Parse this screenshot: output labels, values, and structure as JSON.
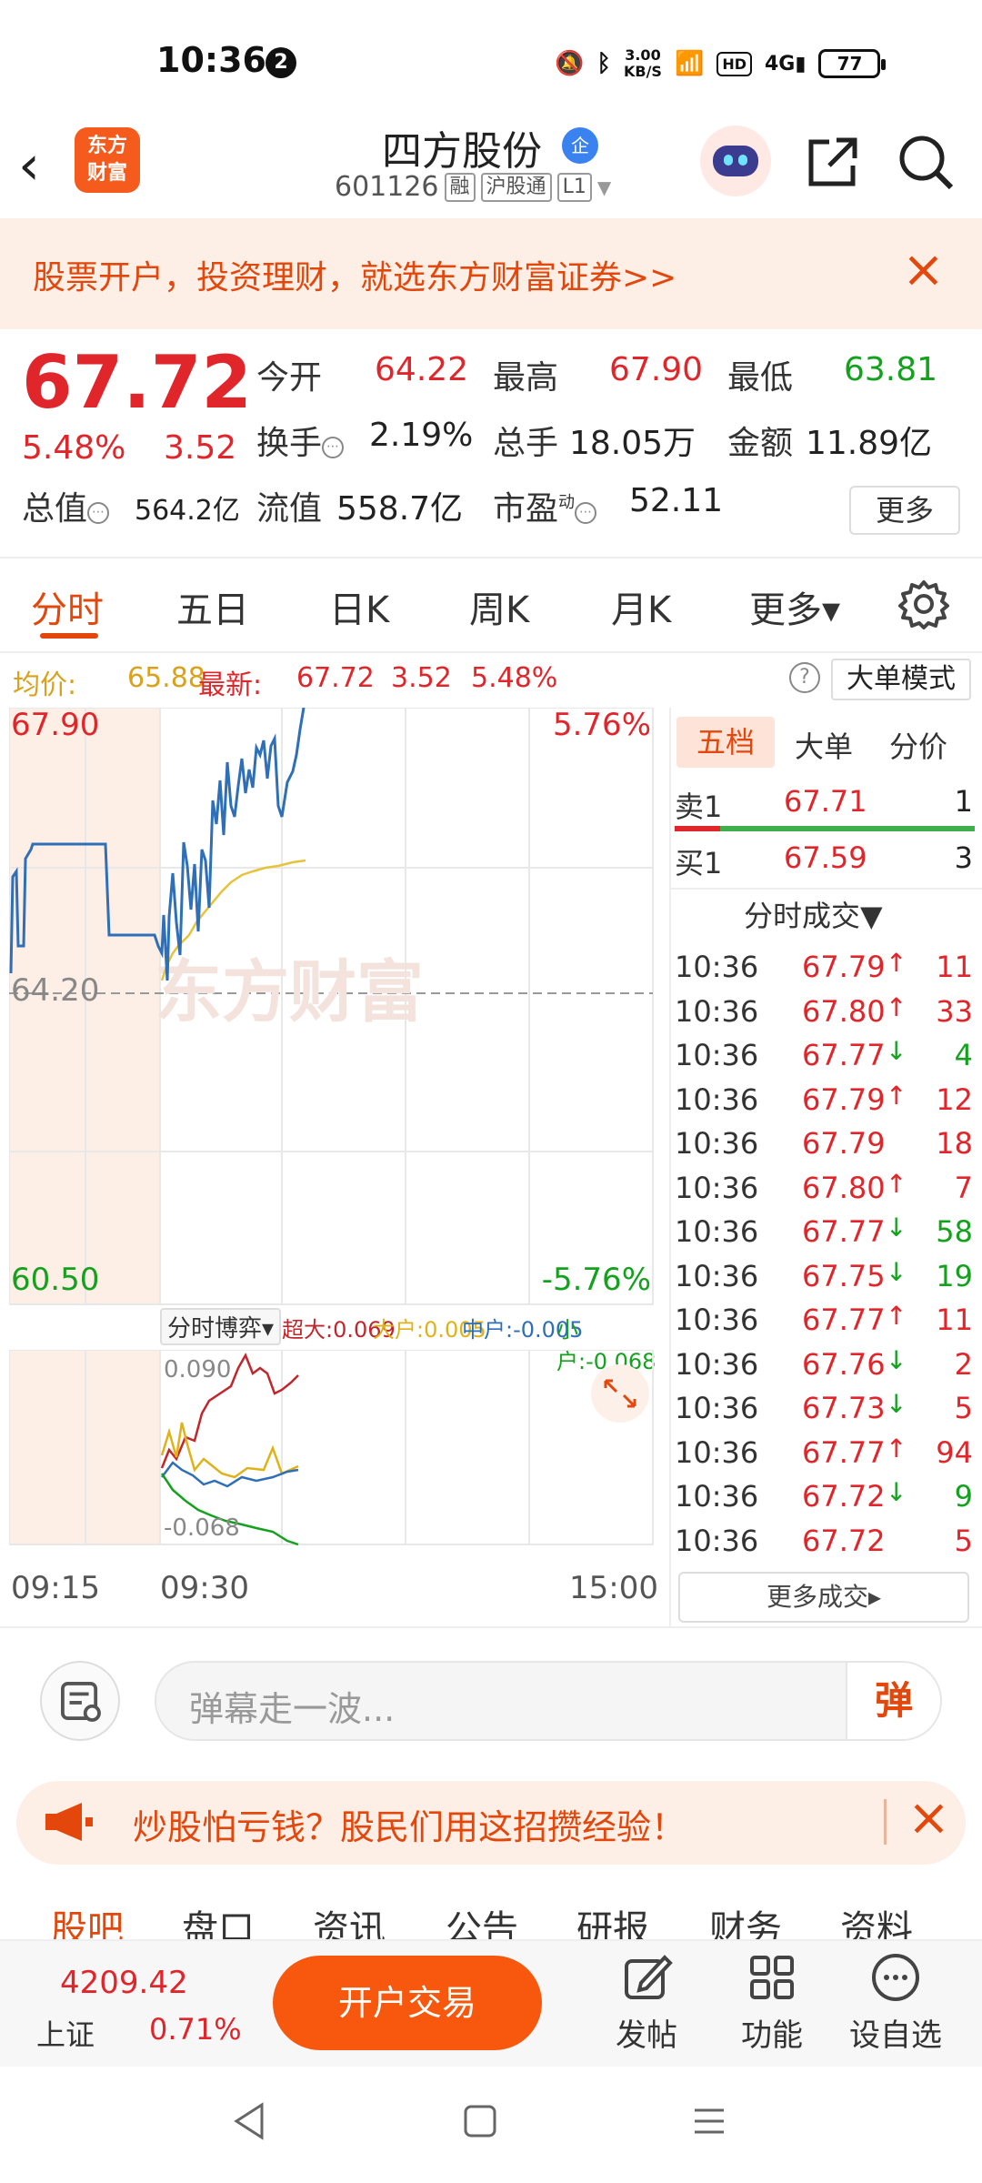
{
  "status": {
    "time": "10:36",
    "notif_count": "2",
    "speed": "3.00",
    "speed_unit": "KB/S",
    "hd": "HD",
    "battery": "77"
  },
  "header": {
    "logo": "东方财富",
    "stock_name": "四方股份",
    "badge": "企",
    "code": "601126",
    "tag_margin": "融",
    "tag_connect": "沪股通",
    "tag_level": "L1"
  },
  "banner": {
    "text": "股票开户，投资理财，就选东方财富证券>>"
  },
  "quote": {
    "price": "67.72",
    "change_pct": "5.48%",
    "change": "3.52",
    "open_label": "今开",
    "open": "64.22",
    "high_label": "最高",
    "high": "67.90",
    "low_label": "最低",
    "low": "63.81",
    "turnover_label": "换手",
    "turnover": "2.19%",
    "volume_label": "总手",
    "volume": "18.05万",
    "amount_label": "金额",
    "amount": "11.89亿",
    "mcap_label": "总值",
    "mcap": "564.2亿",
    "float_label": "流值",
    "float": "558.7亿",
    "pe_label": "市盈",
    "pe_sup": "动",
    "pe": "52.11",
    "more": "更多"
  },
  "tabs": [
    {
      "label": "分时"
    },
    {
      "label": "五日"
    },
    {
      "label": "日K"
    },
    {
      "label": "周K"
    },
    {
      "label": "月K"
    },
    {
      "label": "更多▾"
    }
  ],
  "avgrow": {
    "avg_label": "均价:",
    "avg": "65.88",
    "latest_label": "最新:",
    "latest": "67.72",
    "chg": "3.52",
    "pct": "5.48%",
    "mode": "大单模式"
  },
  "chart": {
    "y_high": "67.90",
    "y_low": "60.50",
    "y_base": "64.20",
    "pct_high": "5.76%",
    "pct_low": "-5.76%",
    "watermark": "东方财富",
    "flow_title": "分时博弈▾",
    "flow_super": "超大:0.069",
    "flow_big": "大户:0.005",
    "flow_mid": "中户:-0.005",
    "flow_small": "小户:-0.068",
    "flow_top": "0.090",
    "flow_bottom": "-0.068",
    "t_start": "09:15",
    "t_open": "09:30",
    "t_close": "15:00"
  },
  "orderbook": {
    "tabs": [
      {
        "label": "五档"
      },
      {
        "label": "大单"
      },
      {
        "label": "分价"
      }
    ],
    "sell": {
      "label": "卖1",
      "price": "67.71",
      "vol": "1"
    },
    "buy": {
      "label": "买1",
      "price": "67.59",
      "vol": "3"
    },
    "trades_title": "分时成交▼",
    "trades": [
      {
        "t": "10:36",
        "p": "67.79",
        "d": "↑",
        "v": "11",
        "vc": "red"
      },
      {
        "t": "10:36",
        "p": "67.80",
        "d": "↑",
        "v": "33",
        "vc": "red"
      },
      {
        "t": "10:36",
        "p": "67.77",
        "d": "↓",
        "v": "4",
        "vc": "green"
      },
      {
        "t": "10:36",
        "p": "67.79",
        "d": "↑",
        "v": "12",
        "vc": "red"
      },
      {
        "t": "10:36",
        "p": "67.79",
        "d": "",
        "v": "18",
        "vc": "red"
      },
      {
        "t": "10:36",
        "p": "67.80",
        "d": "↑",
        "v": "7",
        "vc": "red"
      },
      {
        "t": "10:36",
        "p": "67.77",
        "d": "↓",
        "v": "58",
        "vc": "green"
      },
      {
        "t": "10:36",
        "p": "67.75",
        "d": "↓",
        "v": "19",
        "vc": "green"
      },
      {
        "t": "10:36",
        "p": "67.77",
        "d": "↑",
        "v": "11",
        "vc": "red"
      },
      {
        "t": "10:36",
        "p": "67.76",
        "d": "↓",
        "v": "2",
        "vc": "red"
      },
      {
        "t": "10:36",
        "p": "67.73",
        "d": "↓",
        "v": "5",
        "vc": "red"
      },
      {
        "t": "10:36",
        "p": "67.77",
        "d": "↑",
        "v": "94",
        "vc": "red"
      },
      {
        "t": "10:36",
        "p": "67.72",
        "d": "↓",
        "v": "9",
        "vc": "green"
      },
      {
        "t": "10:36",
        "p": "67.72",
        "d": "",
        "v": "5",
        "vc": "red"
      }
    ],
    "more_trades": "更多成交▸"
  },
  "chat": {
    "placeholder": "弹幕走一波...",
    "send": "弹"
  },
  "promo": {
    "text": "炒股怕亏钱？股民们用这招攒经验！"
  },
  "subtabs": [
    {
      "label": "股吧"
    },
    {
      "label": "盘口"
    },
    {
      "label": "资讯"
    },
    {
      "label": "公告"
    },
    {
      "label": "研报"
    },
    {
      "label": "财务"
    },
    {
      "label": "资料"
    }
  ],
  "bottom": {
    "index_value": "4209.42",
    "index_name": "上证",
    "index_pct": "0.71%",
    "trade": "开户交易",
    "post": "发帖",
    "func": "功能",
    "watch": "设自选"
  },
  "colors": {
    "accent": "#e3470b",
    "up": "#e0262b",
    "down": "#14a11e",
    "price_line": "#2f6fb7",
    "avg_line": "#e8c23a"
  }
}
